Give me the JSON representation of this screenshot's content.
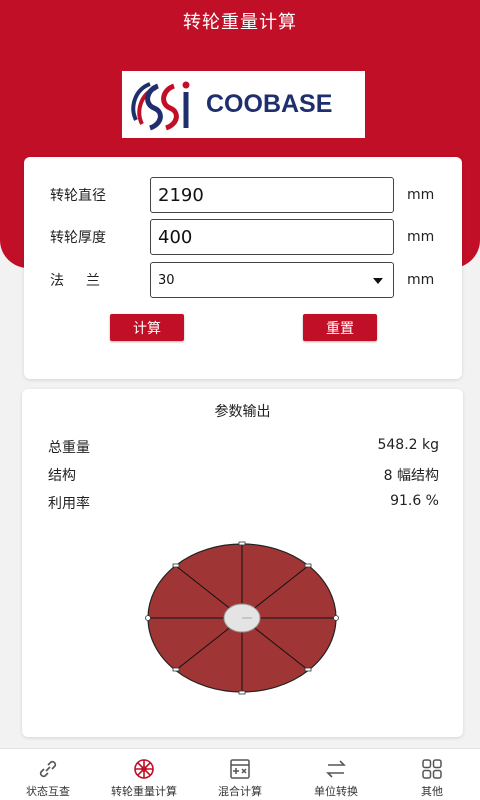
{
  "header": {
    "title": "转轮重量计算"
  },
  "logo": {
    "text": "COOBASE"
  },
  "form": {
    "diameter": {
      "label": "转轮直径",
      "value": "2190",
      "unit": "mm"
    },
    "thickness": {
      "label": "转轮厚度",
      "value": "400",
      "unit": "mm"
    },
    "flange": {
      "label": "法兰",
      "value": "30",
      "unit": "mm"
    },
    "calc_label": "计算",
    "reset_label": "重置"
  },
  "output": {
    "title": "参数输出",
    "rows": [
      {
        "key": "总重量",
        "value": "548.2 kg"
      },
      {
        "key": "结构",
        "value": "8 幅结构"
      },
      {
        "key": "利用率",
        "value": "91.6 %"
      }
    ]
  },
  "colors": {
    "brand_red": "#c00f26",
    "wheel_fill": "#a03535",
    "logo_blue": "#1f2f6e"
  },
  "tabs": [
    {
      "label": "状态互查",
      "icon": "link-icon"
    },
    {
      "label": "转轮重量计算",
      "icon": "wheel-icon",
      "active": true
    },
    {
      "label": "混合计算",
      "icon": "calculator-icon"
    },
    {
      "label": "单位转换",
      "icon": "swap-arrows-icon"
    },
    {
      "label": "其他",
      "icon": "grid-icon"
    }
  ]
}
